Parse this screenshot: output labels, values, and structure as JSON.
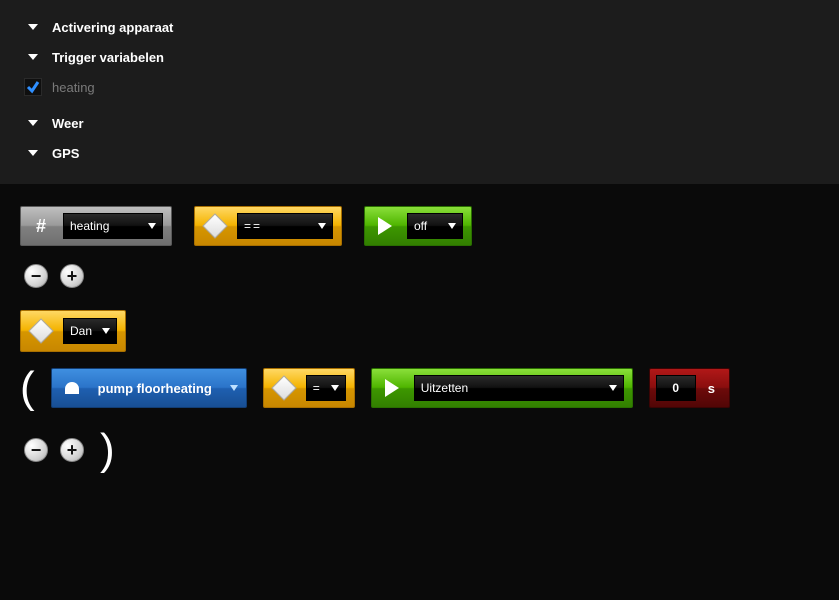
{
  "accordion": {
    "items": [
      {
        "label": "Activering apparaat",
        "expanded": false
      },
      {
        "label": "Trigger variabelen",
        "expanded": true
      },
      {
        "label": "Weer",
        "expanded": false
      },
      {
        "label": "GPS",
        "expanded": false
      }
    ],
    "trigger_var": {
      "label": "heating",
      "checked": true
    }
  },
  "rule": {
    "condition": {
      "var_label": "heating",
      "operator": "==",
      "value": "off"
    },
    "then": {
      "keyword": "Dan"
    },
    "action": {
      "device": "pump floorheating",
      "assign_op": "=",
      "command": "Uitzetten",
      "delay_value": "0",
      "delay_unit": "s"
    }
  }
}
